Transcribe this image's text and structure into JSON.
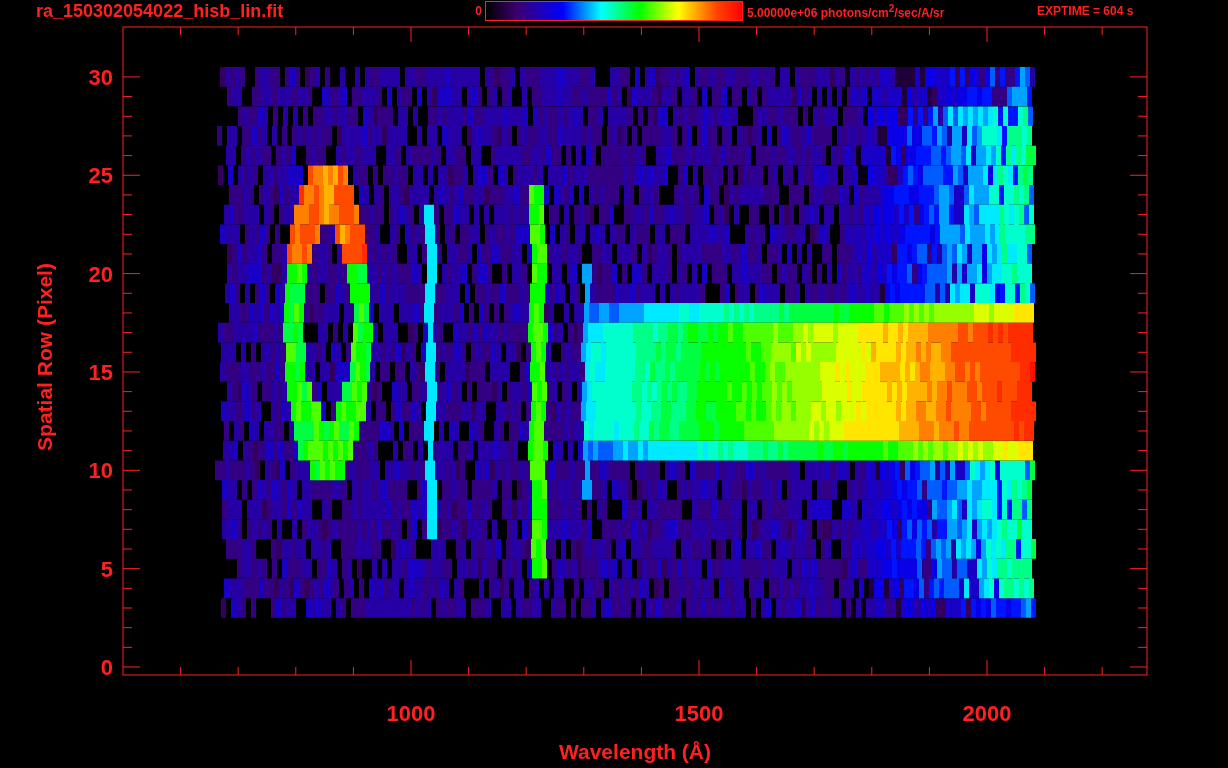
{
  "header": {
    "filename": "ra_150302054022_hisb_lin.fit",
    "colorbar": {
      "min_label": "0",
      "max_label": "5.00000e+06 photons/cm$^{2}$/sec/A/sr"
    },
    "exptime": "EXPTIME = 604 s"
  },
  "plot": {
    "xlabel": "Wavelength (Å)",
    "ylabel": "Spatial Row (Pixel)",
    "xticks": [
      "1000",
      "1500",
      "2000"
    ],
    "yticks": [
      "30",
      "25",
      "20",
      "15",
      "10",
      "5",
      "0"
    ]
  }
}
